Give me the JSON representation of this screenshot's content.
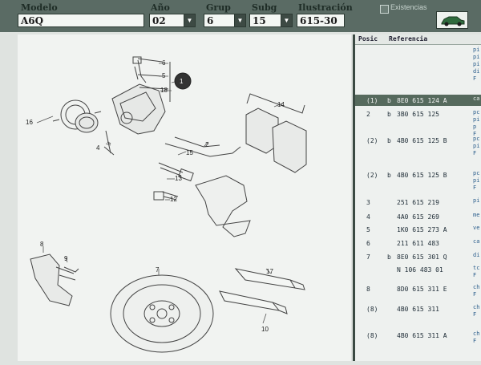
{
  "header": {
    "modelo": {
      "label": "Modelo",
      "value": "A6Q"
    },
    "ano": {
      "label": "Año",
      "value": "02"
    },
    "grup": {
      "label": "Grup",
      "value": "6"
    },
    "subg": {
      "label": "Subg",
      "value": "15"
    },
    "ilustracion": {
      "label": "Ilustración",
      "value": "615-30"
    },
    "existencias_label": "Existencias",
    "car_icon": "car-icon"
  },
  "diagram": {
    "callouts": [
      "6",
      "5",
      "18",
      "1",
      "16",
      "4",
      "14",
      "2",
      "15",
      "13",
      "12",
      "8",
      "9",
      "7",
      "17",
      "10"
    ]
  },
  "parts_table": {
    "columns": [
      "Posic",
      "Referencia"
    ],
    "rows": [
      {
        "pos": "",
        "flag": "",
        "ref": "",
        "desc": "pi\npi\npi\ndi\nF"
      },
      {
        "pos": "(1)",
        "flag": "b",
        "ref": "8E0 615 124 A",
        "desc": "ca",
        "selected": true
      },
      {
        "pos": "2",
        "flag": "b",
        "ref": "3B0 615 125",
        "desc": "pc\npi\np\nF"
      },
      {
        "pos": "(2)",
        "flag": "b",
        "ref": "4B0 615 125 B",
        "desc": "pc\npi\nF"
      },
      {
        "pos": "(2)",
        "flag": "b",
        "ref": "4B0 615 125 B",
        "desc": "pc\npi\nF"
      },
      {
        "pos": "3",
        "flag": "",
        "ref": "251 615 219",
        "desc": "pi"
      },
      {
        "pos": "4",
        "flag": "",
        "ref": "4A0 615 269",
        "desc": "me"
      },
      {
        "pos": "5",
        "flag": "",
        "ref": "1K0 615 273 A",
        "desc": "ve"
      },
      {
        "pos": "6",
        "flag": "",
        "ref": "211 611 483",
        "desc": "ca"
      },
      {
        "pos": "7",
        "flag": "b",
        "ref": "8E0 615 301 Q",
        "desc": "di"
      },
      {
        "pos": "",
        "flag": "",
        "ref": "N  106 483 01",
        "desc": "tc\nF"
      },
      {
        "pos": "8",
        "flag": "",
        "ref": "8D0 615 311 E",
        "desc": "ch\nF"
      },
      {
        "pos": "(8)",
        "flag": "",
        "ref": "4B0 615 311",
        "desc": "ch\nF"
      },
      {
        "pos": "(8)",
        "flag": "",
        "ref": "4B0 615 311 A",
        "desc": "ch\nF"
      }
    ]
  }
}
